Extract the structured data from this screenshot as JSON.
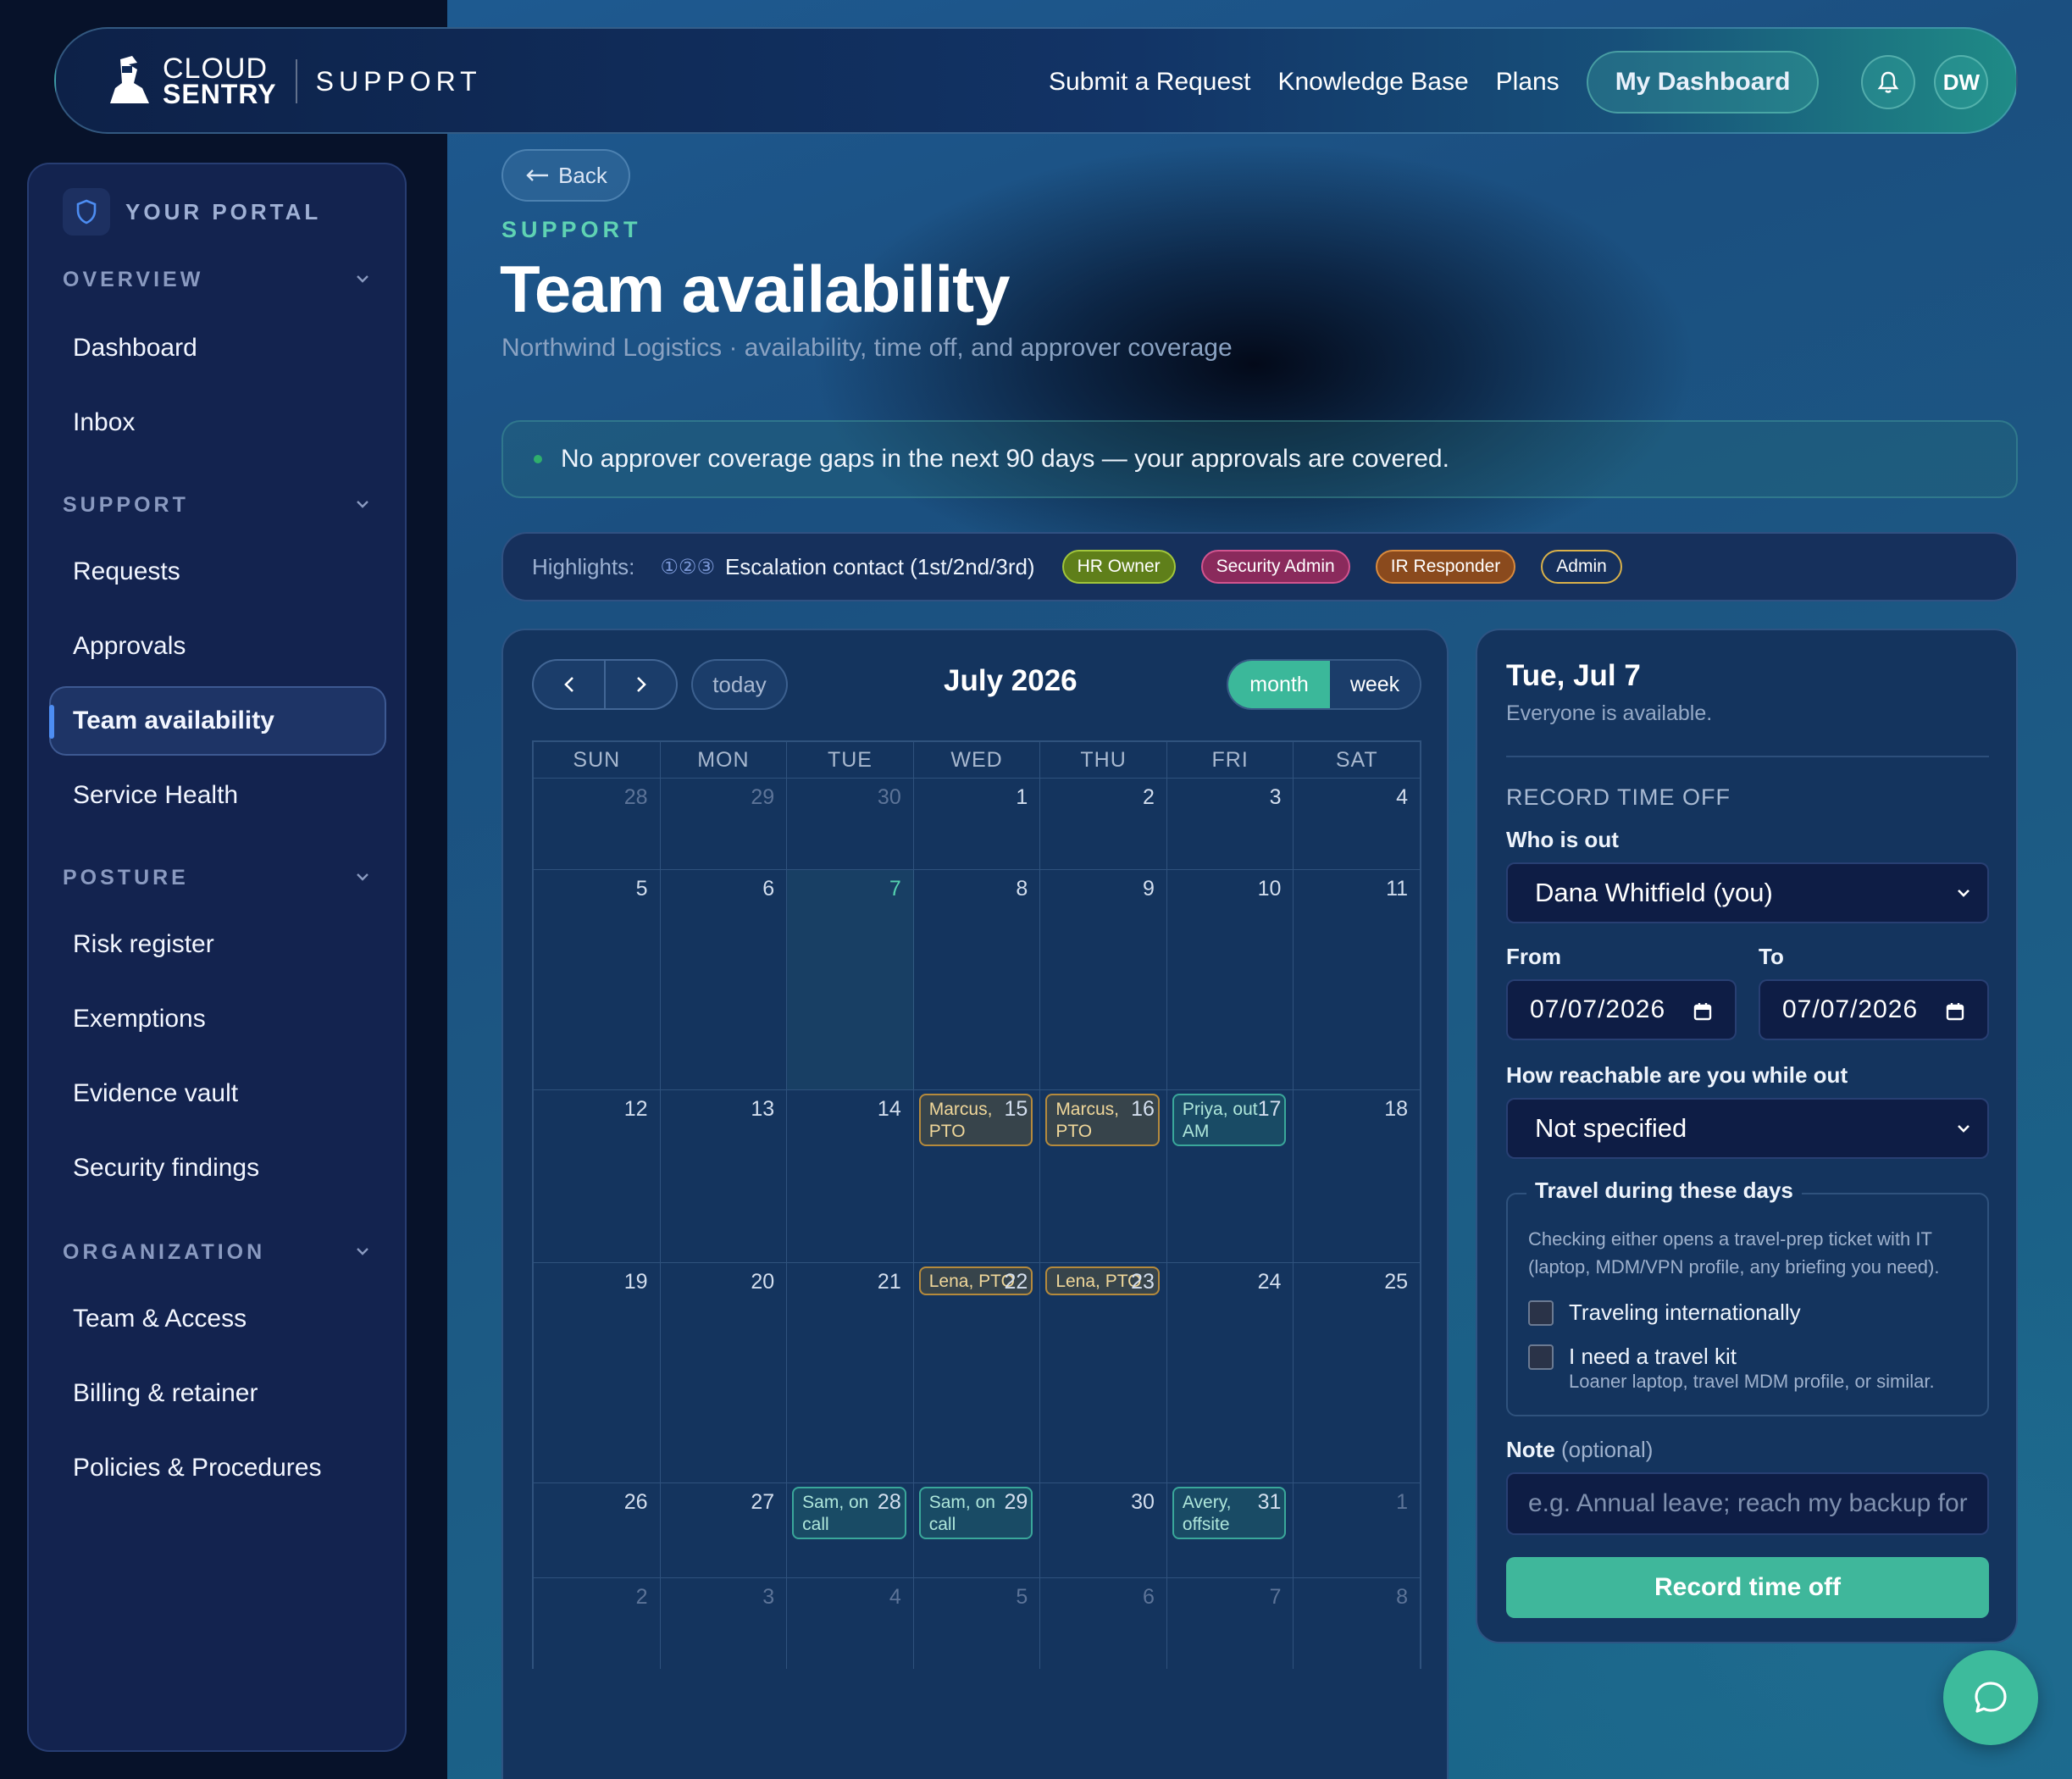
{
  "header": {
    "brand_line1": "CLOUD",
    "brand_line2": "SENTRY",
    "brand_product": "SUPPORT",
    "nav": [
      "Submit a Request",
      "Knowledge Base",
      "Plans"
    ],
    "dashboard_label": "My Dashboard",
    "avatar_initials": "DW"
  },
  "sidebar": {
    "portal_label": "YOUR PORTAL",
    "sections": [
      {
        "title": "OVERVIEW",
        "items": [
          "Dashboard",
          "Inbox"
        ]
      },
      {
        "title": "SUPPORT",
        "items": [
          "Requests",
          "Approvals",
          "Team availability",
          "Service Health"
        ]
      },
      {
        "title": "POSTURE",
        "items": [
          "Risk register",
          "Exemptions",
          "Evidence vault",
          "Security findings"
        ]
      },
      {
        "title": "ORGANIZATION",
        "items": [
          "Team & Access",
          "Billing & retainer",
          "Policies & Procedures"
        ]
      }
    ],
    "active_item": "Team availability"
  },
  "page": {
    "back_label": "Back",
    "eyebrow": "SUPPORT",
    "title": "Team availability",
    "subtitle": "Northwind Logistics · availability, time off, and approver coverage",
    "banner": "No approver coverage gaps in the next 90 days — your approvals are covered.",
    "highlights_label": "Highlights:",
    "highlights_nums": "①②③",
    "highlights_escalation": "Escalation contact (1st/2nd/3rd)",
    "roles": [
      "HR Owner",
      "Security Admin",
      "IR Responder",
      "Admin"
    ]
  },
  "calendar": {
    "today_label": "today",
    "month_title": "July 2026",
    "view_month": "month",
    "view_week": "week",
    "weekdays": [
      "SUN",
      "MON",
      "TUE",
      "WED",
      "THU",
      "FRI",
      "SAT"
    ],
    "weeks": [
      [
        {
          "d": "28",
          "o": true
        },
        {
          "d": "29",
          "o": true
        },
        {
          "d": "30",
          "o": true
        },
        {
          "d": "1"
        },
        {
          "d": "2"
        },
        {
          "d": "3"
        },
        {
          "d": "4"
        }
      ],
      [
        {
          "d": "5"
        },
        {
          "d": "6"
        },
        {
          "d": "7",
          "today": true
        },
        {
          "d": "8"
        },
        {
          "d": "9"
        },
        {
          "d": "10"
        },
        {
          "d": "11"
        }
      ],
      [
        {
          "d": "12"
        },
        {
          "d": "13"
        },
        {
          "d": "14"
        },
        {
          "d": "15",
          "evt": "Marcus, PTO",
          "k": "pto"
        },
        {
          "d": "16",
          "evt": "Marcus, PTO",
          "k": "pto"
        },
        {
          "d": "17",
          "evt": "Priya, out AM",
          "k": "half"
        },
        {
          "d": "18"
        }
      ],
      [
        {
          "d": "19"
        },
        {
          "d": "20"
        },
        {
          "d": "21"
        },
        {
          "d": "22",
          "evt": "Lena, PTO",
          "k": "pto pto1"
        },
        {
          "d": "23",
          "evt": "Lena, PTO",
          "k": "pto pto1"
        },
        {
          "d": "24"
        },
        {
          "d": "25"
        }
      ],
      [
        {
          "d": "26"
        },
        {
          "d": "27"
        },
        {
          "d": "28",
          "evt": "Sam, on call",
          "k": "oncall"
        },
        {
          "d": "29",
          "evt": "Sam, on call",
          "k": "oncall"
        },
        {
          "d": "30"
        },
        {
          "d": "31",
          "evt": "Avery, offsite",
          "k": "oncall"
        },
        {
          "d": "1",
          "o": true
        }
      ],
      [
        {
          "d": "2",
          "o": true
        },
        {
          "d": "3",
          "o": true
        },
        {
          "d": "4",
          "o": true
        },
        {
          "d": "5",
          "o": true
        },
        {
          "d": "6",
          "o": true
        },
        {
          "d": "7",
          "o": true
        },
        {
          "d": "8",
          "o": true
        }
      ]
    ]
  },
  "panel": {
    "date": "Tue, Jul 7",
    "status": "Everyone is available.",
    "section": "RECORD TIME OFF",
    "who_label": "Who is out",
    "who_value": "Dana Whitfield (you)",
    "from_label": "From",
    "from_value": "07/07/2026",
    "to_label": "To",
    "to_value": "07/07/2026",
    "reach_label": "How reachable are you while out",
    "reach_value": "Not specified",
    "travel_legend": "Travel during these days",
    "travel_desc": "Checking either opens a travel-prep ticket with IT (laptop, MDM/VPN profile, any briefing you need).",
    "travel_intl": "Traveling internationally",
    "travel_kit": "I need a travel kit",
    "travel_kit_hint": "Loaner laptop, travel MDM profile, or similar.",
    "note_label": "Note",
    "note_optional": "(optional)",
    "note_placeholder": "e.g. Annual leave; reach my backup for",
    "submit_label": "Record time off"
  },
  "colors": {
    "accent": "#3fb79b",
    "sidebar_bg": "#13234f",
    "pto": "#b58a3c",
    "oncall": "#3aa79a"
  }
}
